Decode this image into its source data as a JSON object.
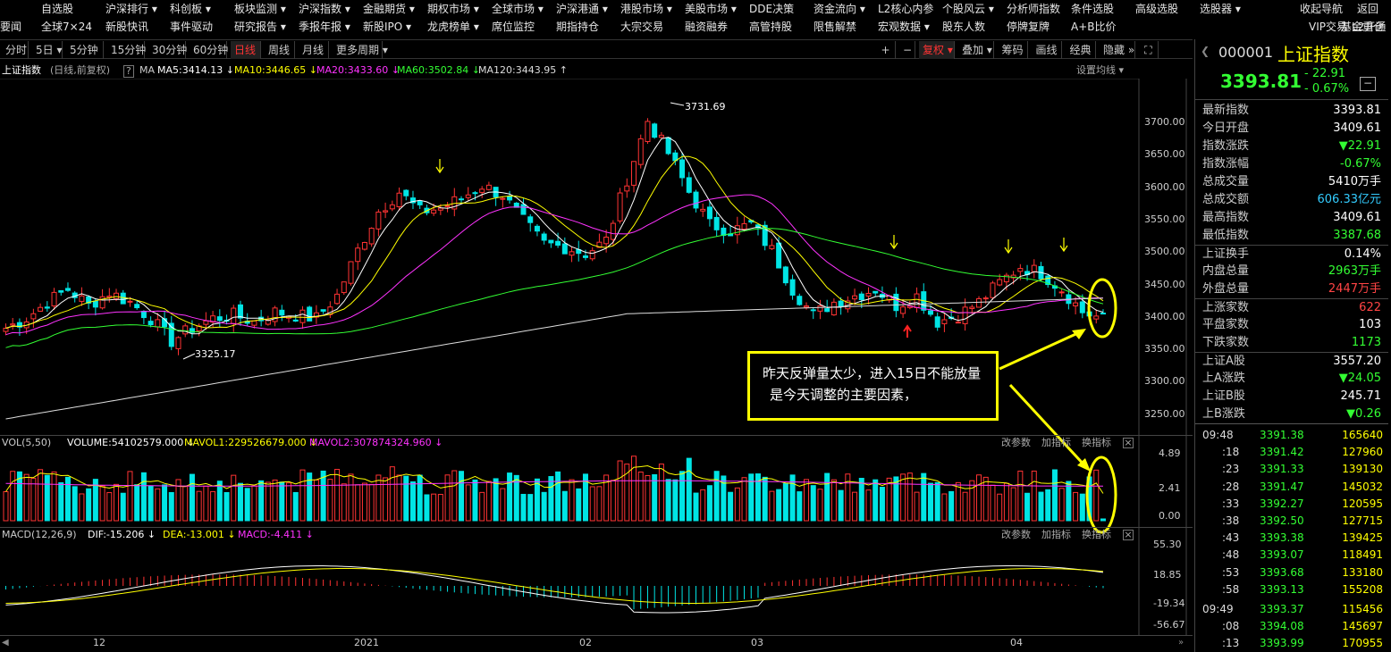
{
  "menu_row1": [
    "自选股",
    "沪深排行 ▾",
    "科创板 ▾",
    "板块监测 ▾",
    "沪深指数 ▾",
    "金融期货 ▾",
    "期权市场 ▾",
    "全球市场 ▾",
    "沪深港通 ▾",
    "港股市场 ▾",
    "美股市场 ▾",
    "DDE决策",
    "资金流向 ▾",
    "L2核心内参",
    "个股风云 ▾",
    "分析师指数",
    "条件选股",
    "高级选股",
    "选股器 ▾",
    "收起导航",
    "返回"
  ],
  "menu_row2": [
    "要闻",
    "全球7×24",
    "新股快讯",
    "事件驱动",
    "研究报告 ▾",
    "季报年报 ▾",
    "新股IPO ▾",
    "龙虎榜单 ▾",
    "席位监控",
    "期指持仓",
    "大宗交易",
    "融资融券",
    "高管持股",
    "限售解禁",
    "宏观数据 ▾",
    "股东人数",
    "停牌复牌",
    "A+B比价",
    "VIP交易",
    "L2开通",
    "基金重仓"
  ],
  "toolbar": [
    "分时",
    "5日 ▾",
    "5分钟",
    "15分钟",
    "30分钟",
    "60分钟",
    "日线",
    "周线",
    "月线",
    "更多周期 ▾"
  ],
  "toolbar_active": "日线",
  "toolbar_right": [
    "+",
    "−",
    "复权 ▾",
    "叠加 ▾",
    "筹码",
    "画线",
    "经典",
    "隐藏 »",
    "⛶"
  ],
  "title": {
    "name": "上证指数",
    "desc": "(日线,前复权)",
    "ma_label": "MA",
    "ma5": "MA5:3414.13 ↓",
    "ma10": "MA10:3446.65 ↓",
    "ma20": "MA20:3433.60 ↓",
    "ma60": "MA60:3502.84 ↓",
    "ma120": "MA120:3443.95 ↑",
    "settings": "设置均线 ▾"
  },
  "price_axis": [
    "3700.00",
    "3650.00",
    "3600.00",
    "3550.00",
    "3500.00",
    "3450.00",
    "3400.00",
    "3350.00",
    "3300.00",
    "3250.00"
  ],
  "high_label": "3731.69",
  "low_label": "3325.17",
  "vol": {
    "label": "VOL(5,50)",
    "volume": "VOLUME:54102579.000 ↓",
    "mavol1": "MAVOL1:229526679.000 ↓",
    "mavol2": "MAVOL2:307874324.960 ↓",
    "axis": [
      "4.89",
      "2.41",
      "0.00"
    ],
    "actions": [
      "改参数",
      "加指标",
      "换指标"
    ]
  },
  "macd": {
    "label": "MACD(12,26,9)",
    "dif": "DIF:-15.206 ↓",
    "dea": "DEA:-13.001 ↓",
    "macd": "MACD:-4.411 ↓",
    "axis": [
      "55.30",
      "18.85",
      "-19.34",
      "-56.67"
    ],
    "actions": [
      "改参数",
      "加指标",
      "换指标"
    ]
  },
  "date_axis": [
    "12",
    "2021",
    "02",
    "03",
    "04"
  ],
  "callout": {
    "line1": "昨天反弹量太少，进入15日不能放量",
    "line2": "是今天调整的主要因素，"
  },
  "quote": {
    "code": "000001",
    "name": "上证指数",
    "price": "3393.81",
    "change": "- 22.91",
    "pct": "- 0.67%"
  },
  "stats": [
    {
      "label": "最新指数",
      "value": "3393.81",
      "color": "#ffffff"
    },
    {
      "label": "今日开盘",
      "value": "3409.61",
      "color": "#ffffff"
    },
    {
      "label": "指数涨跌",
      "value": "▼22.91",
      "color": "#33ff33"
    },
    {
      "label": "指数涨幅",
      "value": "-0.67%",
      "color": "#33ff33"
    },
    {
      "label": "总成交量",
      "value": "5410万手",
      "color": "#ffffff"
    },
    {
      "label": "总成交额",
      "value": "606.33亿元",
      "color": "#33ccff"
    },
    {
      "label": "最高指数",
      "value": "3409.61",
      "color": "#ffffff"
    },
    {
      "label": "最低指数",
      "value": "3387.68",
      "color": "#33ff33"
    },
    {
      "label": "上证换手",
      "value": "0.14%",
      "color": "#ffffff"
    },
    {
      "label": "内盘总量",
      "value": "2963万手",
      "color": "#33ff33"
    },
    {
      "label": "外盘总量",
      "value": "2447万手",
      "color": "#ff4444"
    },
    {
      "label": "上涨家数",
      "value": "622",
      "color": "#ff4444"
    },
    {
      "label": "平盘家数",
      "value": "103",
      "color": "#ffffff"
    },
    {
      "label": "下跌家数",
      "value": "1173",
      "color": "#33ff33"
    },
    {
      "label": "上证A股",
      "value": "3557.20",
      "color": "#ffffff"
    },
    {
      "label": "上A涨跌",
      "value": "▼24.05",
      "color": "#33ff33"
    },
    {
      "label": "上证B股",
      "value": "245.71",
      "color": "#ffffff"
    },
    {
      "label": "上B涨跌",
      "value": "▼0.26",
      "color": "#33ff33"
    }
  ],
  "ticks": [
    {
      "t": "09:48",
      "p": "3391.38",
      "v": "165640"
    },
    {
      "t": ":18",
      "p": "3391.42",
      "v": "127960"
    },
    {
      "t": ":23",
      "p": "3391.33",
      "v": "139130"
    },
    {
      "t": ":28",
      "p": "3391.47",
      "v": "145032"
    },
    {
      "t": ":33",
      "p": "3392.27",
      "v": "120595"
    },
    {
      "t": ":38",
      "p": "3392.50",
      "v": "127715"
    },
    {
      "t": ":43",
      "p": "3393.38",
      "v": "139425"
    },
    {
      "t": ":48",
      "p": "3393.07",
      "v": "118491"
    },
    {
      "t": ":53",
      "p": "3393.68",
      "v": "133180"
    },
    {
      "t": ":58",
      "p": "3393.13",
      "v": "155208"
    },
    {
      "t": "09:49",
      "p": "3393.37",
      "v": "115456"
    },
    {
      "t": ":08",
      "p": "3394.08",
      "v": "145697"
    },
    {
      "t": ":13",
      "p": "3393.99",
      "v": "170955"
    }
  ],
  "colors": {
    "up": "#ff3333",
    "down": "#00e5e5",
    "ma5": "#ffffff",
    "ma10": "#ffff00",
    "ma20": "#ff33ff",
    "ma60": "#33ff33",
    "ma120": "#dddddd",
    "callout": "#ffff00"
  }
}
